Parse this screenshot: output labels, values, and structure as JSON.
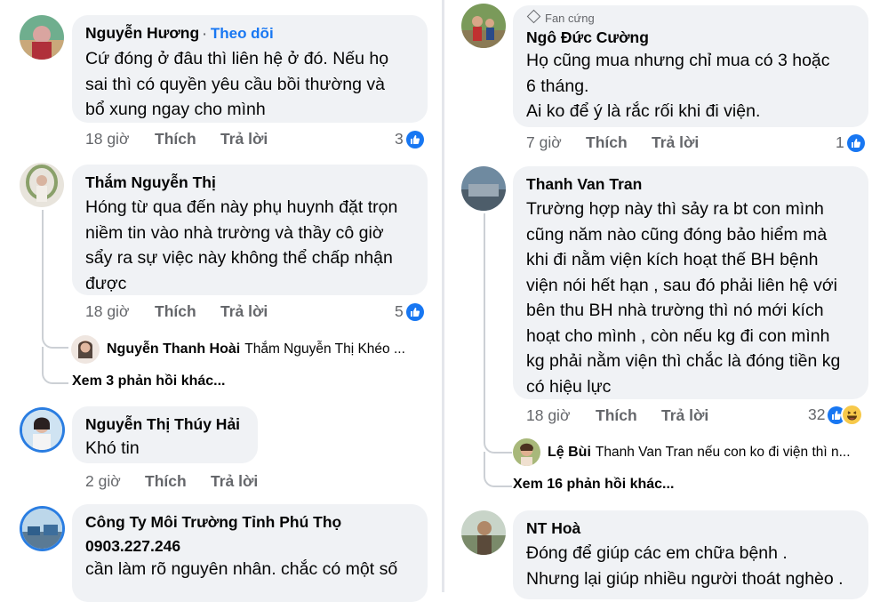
{
  "left": {
    "comments": [
      {
        "name": "Nguyễn Hương",
        "follow": "Theo dõi",
        "lines": [
          "Cứ đóng ở đâu thì liên hệ ở đó. Nếu họ",
          "sai thì có quyền yêu cầu bồi thường và",
          "bổ xung ngay cho mình"
        ],
        "time": "18 giờ",
        "like": "Thích",
        "reply": "Trả lời",
        "reactions": "3"
      },
      {
        "name": "Thắm Nguyễn Thị",
        "lines": [
          "Hóng từ qua đến này phụ huynh đặt trọn",
          "niềm tin vào nhà trường và thầy cô giờ",
          "sẩy ra sự việc này không thể chấp nhận",
          "được"
        ],
        "time": "18 giờ",
        "like": "Thích",
        "reply": "Trả lời",
        "reactions": "5",
        "sub_reply": {
          "name": "Nguyễn Thanh Hoài",
          "text": "Thắm Nguyễn Thị Khéo ..."
        },
        "more": "Xem 3 phản hồi khác..."
      },
      {
        "name": "Nguyễn Thị Thúy Hải",
        "lines": [
          "Khó tin"
        ],
        "time": "2 giờ",
        "like": "Thích",
        "reply": "Trả lời"
      },
      {
        "name": "Công Ty Môi Trường Tỉnh Phú Thọ",
        "lines": [
          "0903.227.246",
          "cần làm rõ nguyên nhân. chắc có một số"
        ]
      }
    ]
  },
  "right": {
    "comments": [
      {
        "badge": "Fan cứng",
        "name": "Ngô Đức Cường",
        "lines": [
          "Họ cũng mua nhưng chỉ mua có 3 hoặc",
          "6 tháng.",
          "Ai ko để ý là rắc rối khi đi viện."
        ],
        "time": "7 giờ",
        "like": "Thích",
        "reply": "Trả lời",
        "reactions": "1"
      },
      {
        "name": "Thanh Van Tran",
        "lines": [
          "Trường hợp này thì sảy ra bt con mình",
          "cũng năm nào cũng đóng bảo hiểm mà",
          "khi đi nằm viện kích hoạt thế BH  bệnh",
          "viện nói hết hạn , sau đó phải liên hệ với",
          "bên thu BH nhà trường thì nó mới kích",
          "hoạt cho mình , còn nếu kg đi con mình",
          "kg phải nằm viện thì chắc là đóng tiền kg",
          "có hiệu lực"
        ],
        "time": "18 giờ",
        "like": "Thích",
        "reply": "Trả lời",
        "reactions": "32",
        "sub_reply": {
          "name": "Lệ Bùi",
          "text": "Thanh Van Tran nếu con ko đi viện thì n..."
        },
        "more": "Xem 16 phản hồi khác..."
      },
      {
        "name": "NT Hoà",
        "lines": [
          "Đóng để giúp các em chữa bệnh .",
          "Nhưng lại giúp nhiều người thoát nghèo ."
        ]
      }
    ]
  },
  "colors": {
    "accent": "#1877f2",
    "bubble": "#f0f2f5",
    "meta": "#65676b"
  }
}
